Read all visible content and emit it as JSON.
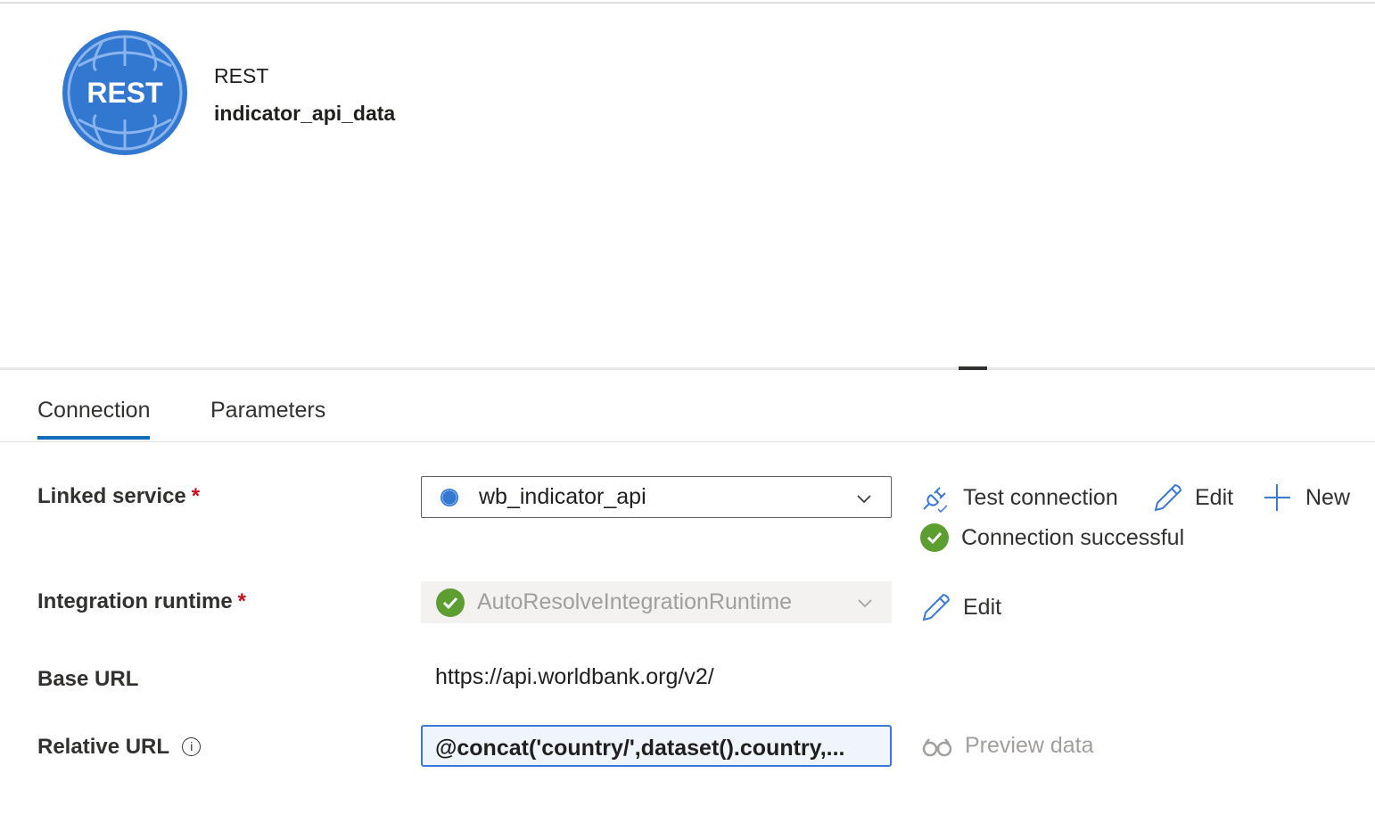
{
  "header": {
    "logo_text": "REST",
    "type": "REST",
    "name": "indicator_api_data"
  },
  "tabs": [
    {
      "label": "Connection",
      "active": true
    },
    {
      "label": "Parameters",
      "active": false
    }
  ],
  "form": {
    "linked_service": {
      "label": "Linked service",
      "required": "*",
      "value": "wb_indicator_api"
    },
    "integration_runtime": {
      "label": "Integration runtime",
      "required": "*",
      "value": "AutoResolveIntegrationRuntime"
    },
    "base_url": {
      "label": "Base URL",
      "value": "https://api.worldbank.org/v2/"
    },
    "relative_url": {
      "label": "Relative URL",
      "info": "i",
      "value": "@concat('country/',dataset().country,..."
    }
  },
  "actions": {
    "test_connection": "Test connection",
    "edit": "Edit",
    "new": "New",
    "status": "Connection successful",
    "ir_edit": "Edit",
    "preview": "Preview data"
  },
  "colors": {
    "accent": "#3b78d8",
    "success": "#5c9e31",
    "required": "#c50f1f"
  }
}
